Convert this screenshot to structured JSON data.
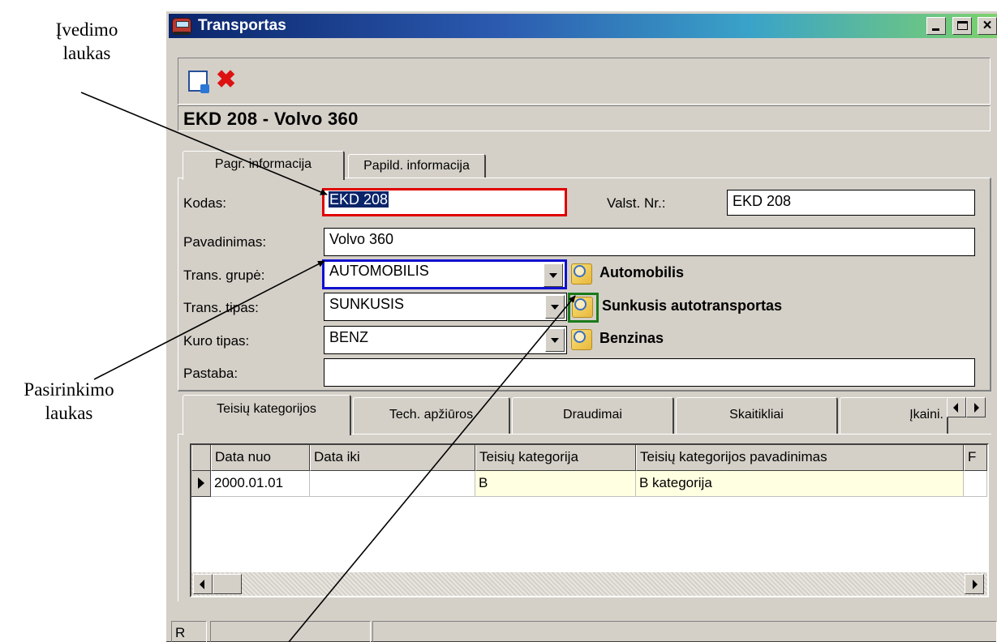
{
  "annotations": {
    "input_field_line1": "Įvedimo",
    "input_field_line2": "laukas",
    "selection_field_line1": "Pasirinkimo",
    "selection_field_line2": "laukas"
  },
  "window": {
    "title": "Transportas",
    "icon": "car-icon",
    "controls": {
      "minimize": "_",
      "maximize": "□",
      "close": "×"
    }
  },
  "toolbar": {
    "icons": [
      "new-document-icon",
      "delete-icon"
    ],
    "delete_glyph": "✖"
  },
  "record_header": "EKD 208 - Volvo  360",
  "tabs": [
    {
      "label": "Pagr. informacija",
      "active": true
    },
    {
      "label": "Papild. informacija",
      "active": false
    }
  ],
  "form": {
    "code": {
      "label": "Kodas:",
      "value": "EKD 208"
    },
    "plate": {
      "label": "Valst. Nr.:",
      "value": "EKD 208"
    },
    "name": {
      "label": "Pavadinimas:",
      "value": "Volvo  360"
    },
    "group": {
      "label": "Trans. grupė:",
      "value": "AUTOMOBILIS",
      "description": "Automobilis"
    },
    "type": {
      "label": "Trans. tipas:",
      "value": "SUNKUSIS",
      "description": "Sunkusis autotransportas"
    },
    "fuel": {
      "label": "Kuro tipas:",
      "value": "BENZ",
      "description": "Benzinas"
    },
    "note": {
      "label": "Pastaba:",
      "value": ""
    }
  },
  "bottom_tabs": [
    {
      "label": "Teisių kategorijos",
      "active": true
    },
    {
      "label": "Tech. apžiūros",
      "active": false
    },
    {
      "label": "Draudimai",
      "active": false
    },
    {
      "label": "Skaitikliai",
      "active": false
    },
    {
      "label": "Įkaini.",
      "active": false
    }
  ],
  "grid": {
    "columns": [
      "Data nuo",
      "Data iki",
      "Teisių kategorija",
      "Teisių kategorijos pavadinimas",
      "F"
    ],
    "rows": [
      [
        "2000.01.01",
        "",
        "B",
        "B kategorija",
        ""
      ]
    ]
  },
  "statusbar": {
    "panels": [
      "R",
      "",
      ""
    ]
  }
}
